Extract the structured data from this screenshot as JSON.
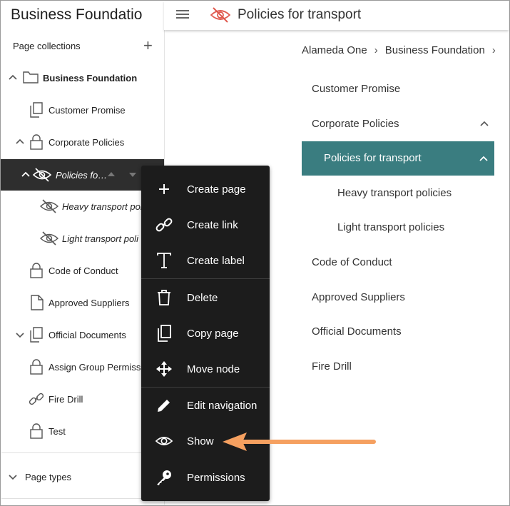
{
  "sidebar": {
    "site_title": "Business Foundatio",
    "page_collections_label": "Page collections",
    "add_icon": "plus-icon",
    "tree": [
      {
        "label": "Business Foundation",
        "icon": "folder-icon",
        "bold": true
      },
      {
        "label": "Customer Promise",
        "icon": "copy-page-icon"
      },
      {
        "label": "Corporate Policies",
        "icon": "lock-icon"
      },
      {
        "label": "Policies fo…",
        "icon": "eye-off-icon",
        "selected": true
      },
      {
        "label": "Heavy transport pol",
        "icon": "eye-off-icon",
        "italic": true
      },
      {
        "label": "Light transport poli",
        "icon": "eye-off-icon",
        "italic": true
      },
      {
        "label": "Code of Conduct",
        "icon": "lock-icon"
      },
      {
        "label": "Approved Suppliers",
        "icon": "page-icon"
      },
      {
        "label": "Official Documents",
        "icon": "copy-page-icon"
      },
      {
        "label": "Assign Group Permiss",
        "icon": "lock-icon"
      },
      {
        "label": "Fire Drill",
        "icon": "link-icon"
      },
      {
        "label": "Test",
        "icon": "lock-icon"
      }
    ],
    "page_types_label": "Page types"
  },
  "header": {
    "title": "Policies for transport",
    "menu_icon": "hamburger-icon",
    "status_icon": "eye-off-icon"
  },
  "breadcrumb": {
    "items": [
      "Alameda One",
      "Business Foundation"
    ]
  },
  "nav": {
    "items": [
      {
        "label": "Customer Promise"
      },
      {
        "label": "Corporate Policies"
      },
      {
        "label": "Policies for transport",
        "active": true
      },
      {
        "label": "Heavy transport policies"
      },
      {
        "label": "Light transport policies"
      },
      {
        "label": "Code of Conduct"
      },
      {
        "label": "Approved Suppliers"
      },
      {
        "label": "Official Documents"
      },
      {
        "label": "Fire Drill"
      }
    ]
  },
  "context_menu": {
    "items": [
      {
        "label": "Create page",
        "icon": "plus-icon"
      },
      {
        "label": "Create link",
        "icon": "link-icon"
      },
      {
        "label": "Create label",
        "icon": "text-icon"
      },
      {
        "label": "Delete",
        "icon": "trash-icon"
      },
      {
        "label": "Copy page",
        "icon": "copy-icon"
      },
      {
        "label": "Move node",
        "icon": "move-icon"
      },
      {
        "label": "Edit navigation",
        "icon": "pencil-icon"
      },
      {
        "label": "Show",
        "icon": "eye-icon"
      },
      {
        "label": "Permissions",
        "icon": "key-icon"
      }
    ]
  },
  "colors": {
    "active_nav": "#3a7d80",
    "menu_bg": "#1c1c1c",
    "arrow": "#f5a060",
    "hidden_icon": "#e05a4f"
  }
}
